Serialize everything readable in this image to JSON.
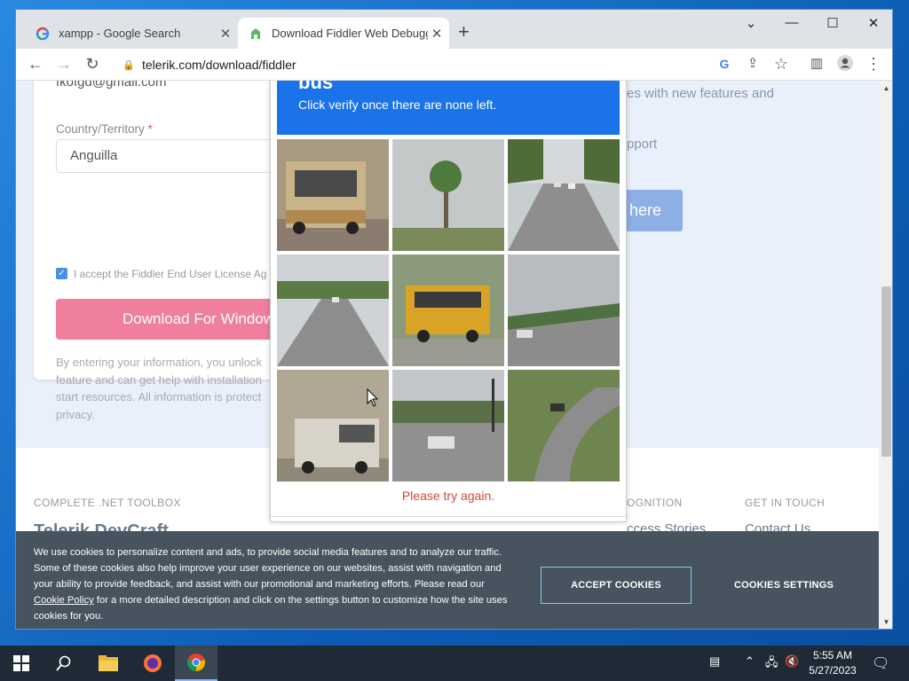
{
  "browser": {
    "tabs": [
      {
        "title": "xampp - Google Search",
        "active": false
      },
      {
        "title": "Download Fiddler Web Debugging",
        "active": true
      }
    ],
    "url": "telerik.com/download/fiddler"
  },
  "form": {
    "email_value": "fkofgd@gmail.com",
    "country_label": "Country/Territory",
    "required_mark": "*",
    "country_value": "Anguilla",
    "accept_text": "I accept the Fiddler End User License Ag",
    "download_button": "Download For Windows",
    "disclaimer": "By entering your information, you unlock\nfeature and can get help with installation\nstart resources. All information is protect\nprivacy."
  },
  "right_panel": {
    "line1": "es with new features and",
    "line2": "pport",
    "here_button": "here"
  },
  "captcha": {
    "heading": "bus",
    "instruction": "Click verify once there are none left.",
    "error": "Please try again.",
    "tiles": [
      "bus-rear",
      "palm-tree",
      "road-cars",
      "road-highway",
      "school-bus",
      "bridge-car",
      "rv-bus",
      "intersection-car",
      "curvy-road-car"
    ]
  },
  "footer": {
    "col1_heading": "COMPLETE .NET TOOLBOX",
    "col1_brand": "Telerik DevCraft",
    "col3_heading": "OGNITION",
    "col3_link": "ccess Stories",
    "col4_heading": "GET IN TOUCH",
    "col4_link": "Contact Us"
  },
  "cookie_banner": {
    "text_before": "We use cookies to personalize content and ads, to provide social media features and to analyze our traffic. Some of these cookies also help improve your user experience on our websites, assist with navigation and your ability to provide feedback, and assist with our promotional and marketing efforts. Please read our ",
    "policy_link": "Cookie Policy",
    "text_after": " for a more detailed description and click on the settings button to customize how the site uses cookies for you.",
    "accept_button": "ACCEPT COOKIES",
    "settings_button": "COOKIES SETTINGS"
  },
  "taskbar": {
    "time": "5:55 AM",
    "date": "5/27/2023"
  },
  "colors": {
    "captcha_header": "#1a73e8",
    "download_button": "#ef7f9c",
    "cookie_banner": "#47535f",
    "error_text": "#d14836"
  }
}
